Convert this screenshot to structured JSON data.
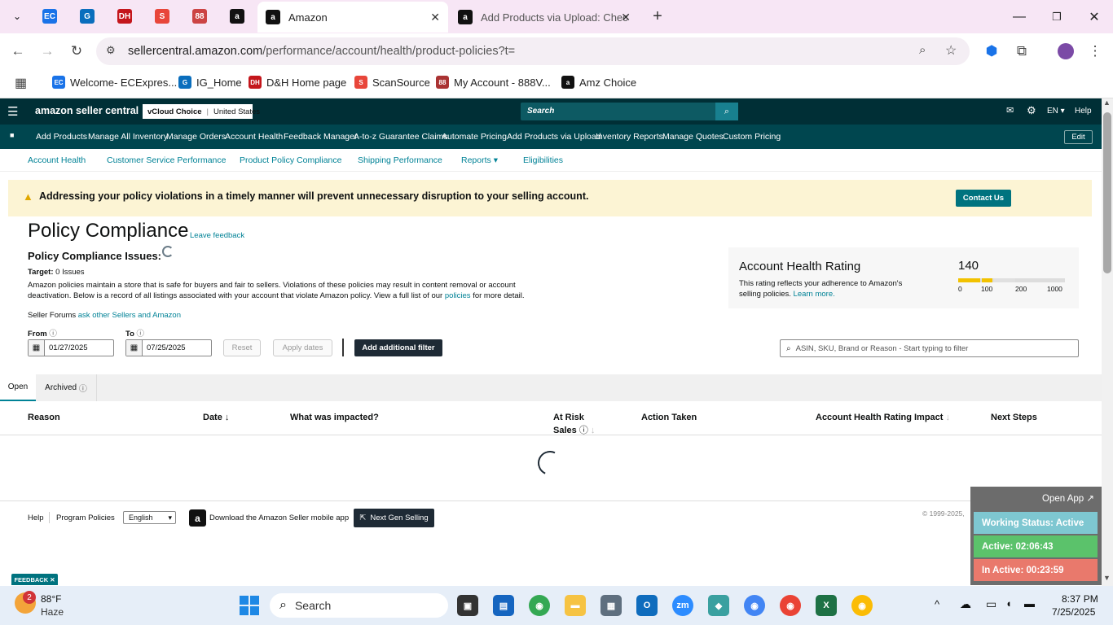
{
  "browser": {
    "tabs": [
      {
        "title": "Amazon",
        "active": true
      },
      {
        "title": "Add Products via Upload: Chec",
        "active": false
      }
    ],
    "url_host": "sellercentral.amazon.com",
    "url_path": "/performance/account/health/product-policies?t=",
    "bookmarks": [
      "Welcome- ECExpres...",
      "IG_Home",
      "D&H Home page",
      "ScanSource",
      "My Account - 888V...",
      "Amz Choice"
    ]
  },
  "header": {
    "logo": "amazon seller central",
    "store": "vCloud Choice",
    "region": "United States",
    "search_placeholder": "Search",
    "lang": "EN",
    "help": "Help"
  },
  "nav": {
    "items": [
      "Add Products",
      "Manage All Inventory",
      "Manage Orders",
      "Account Health",
      "Feedback Manager",
      "A-to-z Guarantee Claims",
      "Automate Pricing",
      "Add Products via Upload",
      "Inventory Reports",
      "Manage Quotes",
      "Custom Pricing"
    ],
    "edit": "Edit"
  },
  "subnav": {
    "items": [
      "Account Health",
      "Customer Service Performance",
      "Product Policy Compliance",
      "Shipping Performance",
      "Reports",
      "Eligibilities"
    ]
  },
  "banner": {
    "text": "Addressing your policy violations in a timely manner will prevent unnecessary disruption to your selling account.",
    "button": "Contact Us"
  },
  "page": {
    "title": "Policy Compliance",
    "leave_feedback": "Leave feedback",
    "issues_heading": "Policy Compliance Issues:",
    "target_label": "Target:",
    "target_value": "0 Issues",
    "desc_1": "Amazon policies maintain a store that is safe for buyers and fair to sellers. Violations of these policies may result in content removal or account",
    "desc_2": "deactivation. Below is a record of all listings associated with your account that violate Amazon policy. View a full list of our",
    "desc_link": "policies",
    "desc_3": "for more detail.",
    "forums_label": "Seller Forums",
    "forums_link": "ask other Sellers and Amazon"
  },
  "ahr": {
    "title": "Account Health Rating",
    "value": "140",
    "desc_1": "This rating reflects your adherence to Amazon's",
    "desc_2": "selling policies.",
    "learn": "Learn more.",
    "scale": [
      "0",
      "100",
      "200",
      "1000"
    ]
  },
  "filters": {
    "from_label": "From",
    "to_label": "To",
    "from_value": "01/27/2025",
    "to_value": "07/25/2025",
    "reset": "Reset",
    "apply": "Apply dates",
    "add_filter": "Add additional filter",
    "filter_placeholder": "ASIN, SKU, Brand or Reason - Start typing to filter"
  },
  "tabs": {
    "open": "Open",
    "archived": "Archived"
  },
  "table": {
    "headers": [
      "Reason",
      "Date",
      "What was impacted?",
      "At Risk",
      "Sales",
      "Action Taken",
      "Account Health Rating Impact",
      "Next Steps"
    ]
  },
  "footer": {
    "help": "Help",
    "policies": "Program Policies",
    "language": "English",
    "app": "Download the Amazon Seller mobile app",
    "nextgen": "Next Gen Selling",
    "copyright": "© 1999-2025,"
  },
  "widget": {
    "open_app": "Open App ↗",
    "status": "Working Status: Active",
    "active": "Active: 02:06:43",
    "inactive": "In Active: 00:23:59"
  },
  "feedback_tab": "FEEDBACK",
  "taskbar": {
    "temp": "88°F",
    "weather": "Haze",
    "badge": "2",
    "search": "Search",
    "time": "8:37 PM",
    "date": "7/25/2025"
  },
  "colors": {
    "header": "#002f36",
    "nav": "#00464f",
    "teal": "#008296",
    "banner": "#fcf4d4",
    "ahr_bar": "#f2c200"
  }
}
